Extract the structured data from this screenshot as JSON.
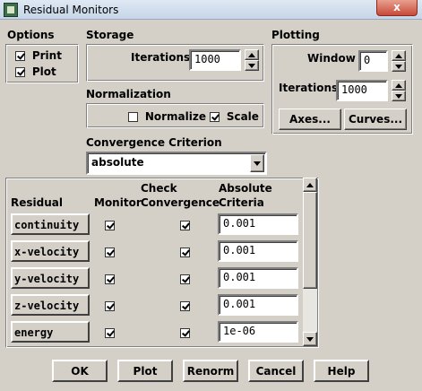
{
  "window": {
    "title": "Residual Monitors",
    "close_glyph": "x"
  },
  "options": {
    "heading": "Options",
    "print": {
      "label": "Print",
      "checked": true
    },
    "plot": {
      "label": "Plot",
      "checked": true
    }
  },
  "storage": {
    "heading": "Storage",
    "iterations_label": "Iterations",
    "iterations_value": "1000"
  },
  "plotting": {
    "heading": "Plotting",
    "window_label": "Window",
    "window_value": "0",
    "iterations_label": "Iterations",
    "iterations_value": "1000",
    "axes_button": "Axes...",
    "curves_button": "Curves..."
  },
  "normalization": {
    "heading": "Normalization",
    "normalize": {
      "label": "Normalize",
      "checked": false
    },
    "scale": {
      "label": "Scale",
      "checked": true
    }
  },
  "convergence": {
    "heading": "Convergence Criterion",
    "selected": "absolute"
  },
  "table": {
    "headers": {
      "residual": "Residual",
      "monitor": "Monitor",
      "check_1": "Check",
      "check_2": "Convergence",
      "abs_1": "Absolute",
      "abs_2": "Criteria"
    },
    "rows": [
      {
        "name": "continuity",
        "monitor": true,
        "check": true,
        "criteria": "0.001"
      },
      {
        "name": "x-velocity",
        "monitor": true,
        "check": true,
        "criteria": "0.001"
      },
      {
        "name": "y-velocity",
        "monitor": true,
        "check": true,
        "criteria": "0.001"
      },
      {
        "name": "z-velocity",
        "monitor": true,
        "check": true,
        "criteria": "0.001"
      },
      {
        "name": "energy",
        "monitor": true,
        "check": true,
        "criteria": "1e-06"
      }
    ]
  },
  "buttons": {
    "ok": "OK",
    "plot": "Plot",
    "renorm": "Renorm",
    "cancel": "Cancel",
    "help": "Help"
  },
  "colors": {
    "dialog_bg": "#d4d0c8",
    "title_bar": "#c5d5e8",
    "close_button": "#c74a3a"
  }
}
